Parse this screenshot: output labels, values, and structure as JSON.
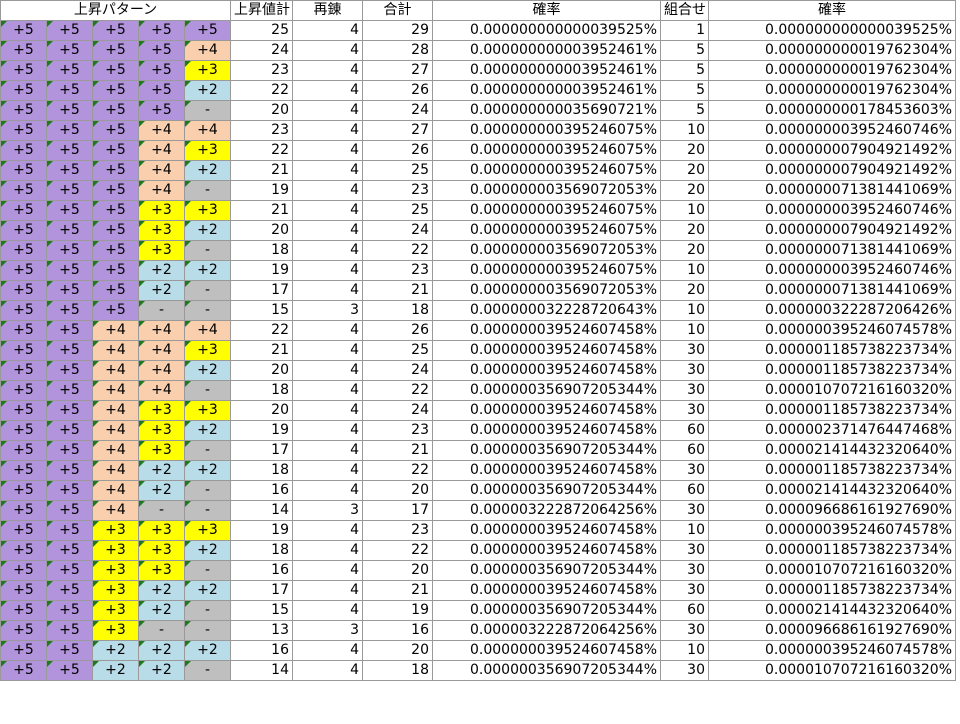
{
  "headers": {
    "pattern": "上昇パターン",
    "rise_total": "上昇値計",
    "renren": "再錬",
    "total": "合計",
    "probability": "確率",
    "combinations": "組合せ",
    "probability2": "確率"
  },
  "pattern_colors": {
    "+5": "#b294dd",
    "+4": "#f9cfae",
    "+3": "#ffff00",
    "+2": "#b8dce8",
    "-": "#bfbfbf"
  },
  "rows": [
    {
      "pattern": [
        "+5",
        "+5",
        "+5",
        "+5",
        "+5"
      ],
      "sum": "25",
      "ren": "4",
      "total": "29",
      "prob": "0.000000000000039525%",
      "comb": "1",
      "prob2": "0.000000000000039525%"
    },
    {
      "pattern": [
        "+5",
        "+5",
        "+5",
        "+5",
        "+4"
      ],
      "sum": "24",
      "ren": "4",
      "total": "28",
      "prob": "0.000000000003952461%",
      "comb": "5",
      "prob2": "0.000000000019762304%"
    },
    {
      "pattern": [
        "+5",
        "+5",
        "+5",
        "+5",
        "+3"
      ],
      "sum": "23",
      "ren": "4",
      "total": "27",
      "prob": "0.000000000003952461%",
      "comb": "5",
      "prob2": "0.000000000019762304%"
    },
    {
      "pattern": [
        "+5",
        "+5",
        "+5",
        "+5",
        "+2"
      ],
      "sum": "22",
      "ren": "4",
      "total": "26",
      "prob": "0.000000000003952461%",
      "comb": "5",
      "prob2": "0.000000000019762304%"
    },
    {
      "pattern": [
        "+5",
        "+5",
        "+5",
        "+5",
        "-"
      ],
      "sum": "20",
      "ren": "4",
      "total": "24",
      "prob": "0.000000000035690721%",
      "comb": "5",
      "prob2": "0.000000000178453603%"
    },
    {
      "pattern": [
        "+5",
        "+5",
        "+5",
        "+4",
        "+4"
      ],
      "sum": "23",
      "ren": "4",
      "total": "27",
      "prob": "0.000000000395246075%",
      "comb": "10",
      "prob2": "0.000000003952460746%"
    },
    {
      "pattern": [
        "+5",
        "+5",
        "+5",
        "+4",
        "+3"
      ],
      "sum": "22",
      "ren": "4",
      "total": "26",
      "prob": "0.000000000395246075%",
      "comb": "20",
      "prob2": "0.000000007904921492%"
    },
    {
      "pattern": [
        "+5",
        "+5",
        "+5",
        "+4",
        "+2"
      ],
      "sum": "21",
      "ren": "4",
      "total": "25",
      "prob": "0.000000000395246075%",
      "comb": "20",
      "prob2": "0.000000007904921492%"
    },
    {
      "pattern": [
        "+5",
        "+5",
        "+5",
        "+4",
        "-"
      ],
      "sum": "19",
      "ren": "4",
      "total": "23",
      "prob": "0.000000003569072053%",
      "comb": "20",
      "prob2": "0.000000071381441069%"
    },
    {
      "pattern": [
        "+5",
        "+5",
        "+5",
        "+3",
        "+3"
      ],
      "sum": "21",
      "ren": "4",
      "total": "25",
      "prob": "0.000000000395246075%",
      "comb": "10",
      "prob2": "0.000000003952460746%"
    },
    {
      "pattern": [
        "+5",
        "+5",
        "+5",
        "+3",
        "+2"
      ],
      "sum": "20",
      "ren": "4",
      "total": "24",
      "prob": "0.000000000395246075%",
      "comb": "20",
      "prob2": "0.000000007904921492%"
    },
    {
      "pattern": [
        "+5",
        "+5",
        "+5",
        "+3",
        "-"
      ],
      "sum": "18",
      "ren": "4",
      "total": "22",
      "prob": "0.000000003569072053%",
      "comb": "20",
      "prob2": "0.000000071381441069%"
    },
    {
      "pattern": [
        "+5",
        "+5",
        "+5",
        "+2",
        "+2"
      ],
      "sum": "19",
      "ren": "4",
      "total": "23",
      "prob": "0.000000000395246075%",
      "comb": "10",
      "prob2": "0.000000003952460746%"
    },
    {
      "pattern": [
        "+5",
        "+5",
        "+5",
        "+2",
        "-"
      ],
      "sum": "17",
      "ren": "4",
      "total": "21",
      "prob": "0.000000003569072053%",
      "comb": "20",
      "prob2": "0.000000071381441069%"
    },
    {
      "pattern": [
        "+5",
        "+5",
        "+5",
        "-",
        "-"
      ],
      "sum": "15",
      "ren": "3",
      "total": "18",
      "prob": "0.000000032228720643%",
      "comb": "10",
      "prob2": "0.000000322287206426%"
    },
    {
      "pattern": [
        "+5",
        "+5",
        "+4",
        "+4",
        "+4"
      ],
      "sum": "22",
      "ren": "4",
      "total": "26",
      "prob": "0.000000039524607458%",
      "comb": "10",
      "prob2": "0.000000395246074578%"
    },
    {
      "pattern": [
        "+5",
        "+5",
        "+4",
        "+4",
        "+3"
      ],
      "sum": "21",
      "ren": "4",
      "total": "25",
      "prob": "0.000000039524607458%",
      "comb": "30",
      "prob2": "0.000001185738223734%"
    },
    {
      "pattern": [
        "+5",
        "+5",
        "+4",
        "+4",
        "+2"
      ],
      "sum": "20",
      "ren": "4",
      "total": "24",
      "prob": "0.000000039524607458%",
      "comb": "30",
      "prob2": "0.000001185738223734%"
    },
    {
      "pattern": [
        "+5",
        "+5",
        "+4",
        "+4",
        "-"
      ],
      "sum": "18",
      "ren": "4",
      "total": "22",
      "prob": "0.000000356907205344%",
      "comb": "30",
      "prob2": "0.000010707216160320%"
    },
    {
      "pattern": [
        "+5",
        "+5",
        "+4",
        "+3",
        "+3"
      ],
      "sum": "20",
      "ren": "4",
      "total": "24",
      "prob": "0.000000039524607458%",
      "comb": "30",
      "prob2": "0.000001185738223734%"
    },
    {
      "pattern": [
        "+5",
        "+5",
        "+4",
        "+3",
        "+2"
      ],
      "sum": "19",
      "ren": "4",
      "total": "23",
      "prob": "0.000000039524607458%",
      "comb": "60",
      "prob2": "0.000002371476447468%"
    },
    {
      "pattern": [
        "+5",
        "+5",
        "+4",
        "+3",
        "-"
      ],
      "sum": "17",
      "ren": "4",
      "total": "21",
      "prob": "0.000000356907205344%",
      "comb": "60",
      "prob2": "0.000021414432320640%"
    },
    {
      "pattern": [
        "+5",
        "+5",
        "+4",
        "+2",
        "+2"
      ],
      "sum": "18",
      "ren": "4",
      "total": "22",
      "prob": "0.000000039524607458%",
      "comb": "30",
      "prob2": "0.000001185738223734%"
    },
    {
      "pattern": [
        "+5",
        "+5",
        "+4",
        "+2",
        "-"
      ],
      "sum": "16",
      "ren": "4",
      "total": "20",
      "prob": "0.000000356907205344%",
      "comb": "60",
      "prob2": "0.000021414432320640%"
    },
    {
      "pattern": [
        "+5",
        "+5",
        "+4",
        "-",
        "-"
      ],
      "sum": "14",
      "ren": "3",
      "total": "17",
      "prob": "0.000003222872064256%",
      "comb": "30",
      "prob2": "0.000096686161927690%"
    },
    {
      "pattern": [
        "+5",
        "+5",
        "+3",
        "+3",
        "+3"
      ],
      "sum": "19",
      "ren": "4",
      "total": "23",
      "prob": "0.000000039524607458%",
      "comb": "10",
      "prob2": "0.000000395246074578%"
    },
    {
      "pattern": [
        "+5",
        "+5",
        "+3",
        "+3",
        "+2"
      ],
      "sum": "18",
      "ren": "4",
      "total": "22",
      "prob": "0.000000039524607458%",
      "comb": "30",
      "prob2": "0.000001185738223734%"
    },
    {
      "pattern": [
        "+5",
        "+5",
        "+3",
        "+3",
        "-"
      ],
      "sum": "16",
      "ren": "4",
      "total": "20",
      "prob": "0.000000356907205344%",
      "comb": "30",
      "prob2": "0.000010707216160320%"
    },
    {
      "pattern": [
        "+5",
        "+5",
        "+3",
        "+2",
        "+2"
      ],
      "sum": "17",
      "ren": "4",
      "total": "21",
      "prob": "0.000000039524607458%",
      "comb": "30",
      "prob2": "0.000001185738223734%"
    },
    {
      "pattern": [
        "+5",
        "+5",
        "+3",
        "+2",
        "-"
      ],
      "sum": "15",
      "ren": "4",
      "total": "19",
      "prob": "0.000000356907205344%",
      "comb": "60",
      "prob2": "0.000021414432320640%"
    },
    {
      "pattern": [
        "+5",
        "+5",
        "+3",
        "-",
        "-"
      ],
      "sum": "13",
      "ren": "3",
      "total": "16",
      "prob": "0.000003222872064256%",
      "comb": "30",
      "prob2": "0.000096686161927690%"
    },
    {
      "pattern": [
        "+5",
        "+5",
        "+2",
        "+2",
        "+2"
      ],
      "sum": "16",
      "ren": "4",
      "total": "20",
      "prob": "0.000000039524607458%",
      "comb": "10",
      "prob2": "0.000000395246074578%"
    },
    {
      "pattern": [
        "+5",
        "+5",
        "+2",
        "+2",
        "-"
      ],
      "sum": "14",
      "ren": "4",
      "total": "18",
      "prob": "0.000000356907205344%",
      "comb": "30",
      "prob2": "0.000010707216160320%"
    }
  ]
}
